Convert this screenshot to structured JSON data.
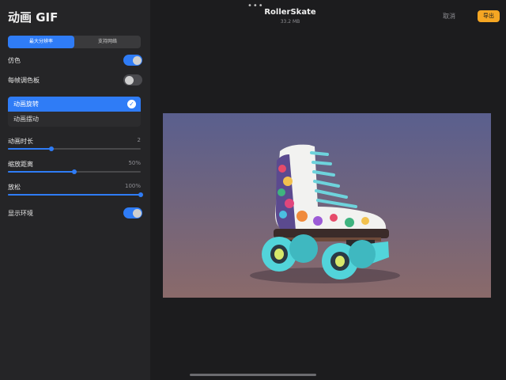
{
  "sidebar": {
    "title": "动画 GIF",
    "segments": [
      {
        "label": "最大分辨率",
        "active": true
      },
      {
        "label": "支持网络",
        "active": false
      }
    ],
    "toggles": {
      "dither": {
        "label": "仿色",
        "on": true
      },
      "palette": {
        "label": "每帧调色板",
        "on": false
      },
      "env": {
        "label": "显示环境",
        "on": true
      }
    },
    "modes": [
      {
        "label": "动画旋转",
        "selected": true
      },
      {
        "label": "动画摆动",
        "selected": false
      }
    ],
    "sliders": {
      "duration": {
        "label": "动画时长",
        "value": "2",
        "fraction": 0.33
      },
      "zoom": {
        "label": "缩放距离",
        "value": "50%",
        "fraction": 0.5
      },
      "ease": {
        "label": "放松",
        "value": "100%",
        "fraction": 1.0
      }
    }
  },
  "header": {
    "more": "•••",
    "doc_title": "RollerSkate",
    "doc_size": "33.2 MB",
    "cancel": "取消",
    "export": "导出"
  },
  "colors": {
    "accent": "#2f7cf6",
    "export": "#f5a623",
    "boot": "#f2f2f0",
    "wheel": "#52d4da",
    "laces": "#6ed3dc"
  },
  "preview": {
    "subject": "roller-skate-icon"
  }
}
